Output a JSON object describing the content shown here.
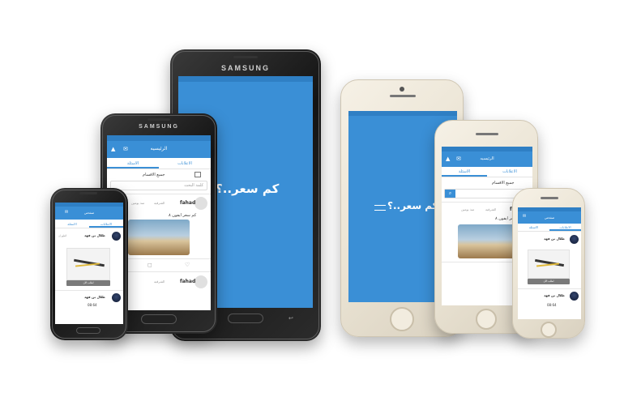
{
  "brand": {
    "android_name": "SAMSUNG"
  },
  "app": {
    "splash_logo": "كم سعر..؟",
    "home_title": "الرئيسيه",
    "profile_title": "صفحتي",
    "tabs": {
      "ads": "الاعلانات",
      "questions": "الاسئلة"
    },
    "all_categories": "جميع الاقسام",
    "search_placeholder": "كلمة البحث",
    "user_fahad": "fahad",
    "post_question": "كم سعر ايفون ٨",
    "location": "الشرقيه",
    "time_ago": "منذ يومين",
    "user_talal": "طلال بن فهد",
    "city_dhahran": "الظهران",
    "price_label": "08:64",
    "see_more": "اطلب الآن"
  },
  "colors": {
    "primary": "#3a8fd6",
    "status": "#2f7fc4"
  }
}
